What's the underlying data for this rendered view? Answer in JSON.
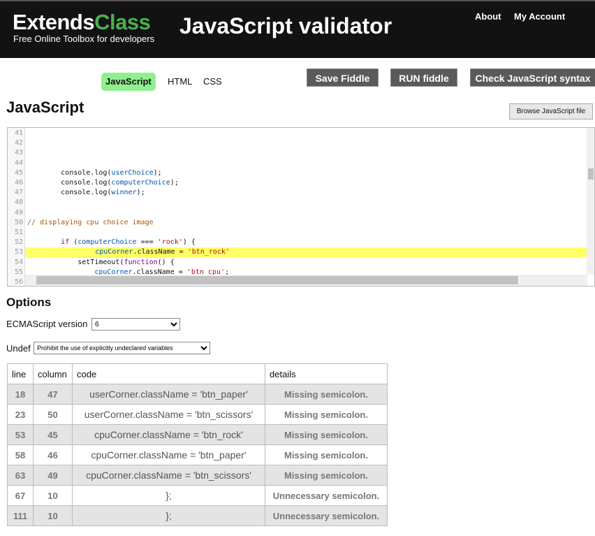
{
  "header": {
    "logo_part1": "Extends",
    "logo_part2": "Class",
    "tagline": "Free Online Toolbox for developers",
    "title": "JavaScript validator",
    "nav": [
      "About",
      "My Account"
    ]
  },
  "tabs": [
    {
      "label": "JavaScript",
      "active": true
    },
    {
      "label": "HTML"
    },
    {
      "label": "CSS"
    }
  ],
  "buttons": {
    "save": "Save Fiddle",
    "run": "RUN fiddle",
    "check": "Check JavaScript syntax",
    "browse": "Browse JavaScript file"
  },
  "section_title": "JavaScript",
  "editor": {
    "highlight_line": 53,
    "lines": [
      {
        "n": "41",
        "t": ""
      },
      {
        "n": "42",
        "t": ""
      },
      {
        "n": "43",
        "t": ""
      },
      {
        "n": "44",
        "t": ""
      },
      {
        "n": "45",
        "t": "        console.log(userChoice);"
      },
      {
        "n": "46",
        "t": "        console.log(computerChoice);"
      },
      {
        "n": "47",
        "t": "        console.log(winner);"
      },
      {
        "n": "48",
        "t": ""
      },
      {
        "n": "49",
        "t": ""
      },
      {
        "n": "50",
        "t": "// displaying cpu choice image"
      },
      {
        "n": "51",
        "t": ""
      },
      {
        "n": "52",
        "t": "        if (computerChoice === 'rock') {"
      },
      {
        "n": "53",
        "t": "            cpuCorner.className = 'btn_rock'"
      },
      {
        "n": "54",
        "t": "            setTimeout(function() {"
      },
      {
        "n": "55",
        "t": "                cpuCorner.className = 'btn cpu';"
      },
      {
        "n": "56",
        "t": ""
      }
    ]
  },
  "options": {
    "title": "Options",
    "ecma_label": "ECMAScript version",
    "ecma_value": "6",
    "undef_label": "Undef",
    "undef_value": "Prohibit the use of explicitly undeclared variables"
  },
  "results": {
    "columns": [
      "line",
      "column",
      "code",
      "details"
    ],
    "rows": [
      [
        "18",
        "47",
        "userCorner.className = 'btn_paper'",
        "Missing semicolon."
      ],
      [
        "23",
        "50",
        "userCorner.className = 'btn_scissors'",
        "Missing semicolon."
      ],
      [
        "53",
        "45",
        "cpuCorner.className = 'btn_rock'",
        "Missing semicolon."
      ],
      [
        "58",
        "46",
        "cpuCorner.className = 'btn_paper'",
        "Missing semicolon."
      ],
      [
        "63",
        "49",
        "cpuCorner.className = 'btn_scissors'",
        "Missing semicolon."
      ],
      [
        "67",
        "10",
        "};",
        "Unnecessary semicolon."
      ],
      [
        "111",
        "10",
        "};",
        "Unnecessary semicolon."
      ]
    ]
  }
}
